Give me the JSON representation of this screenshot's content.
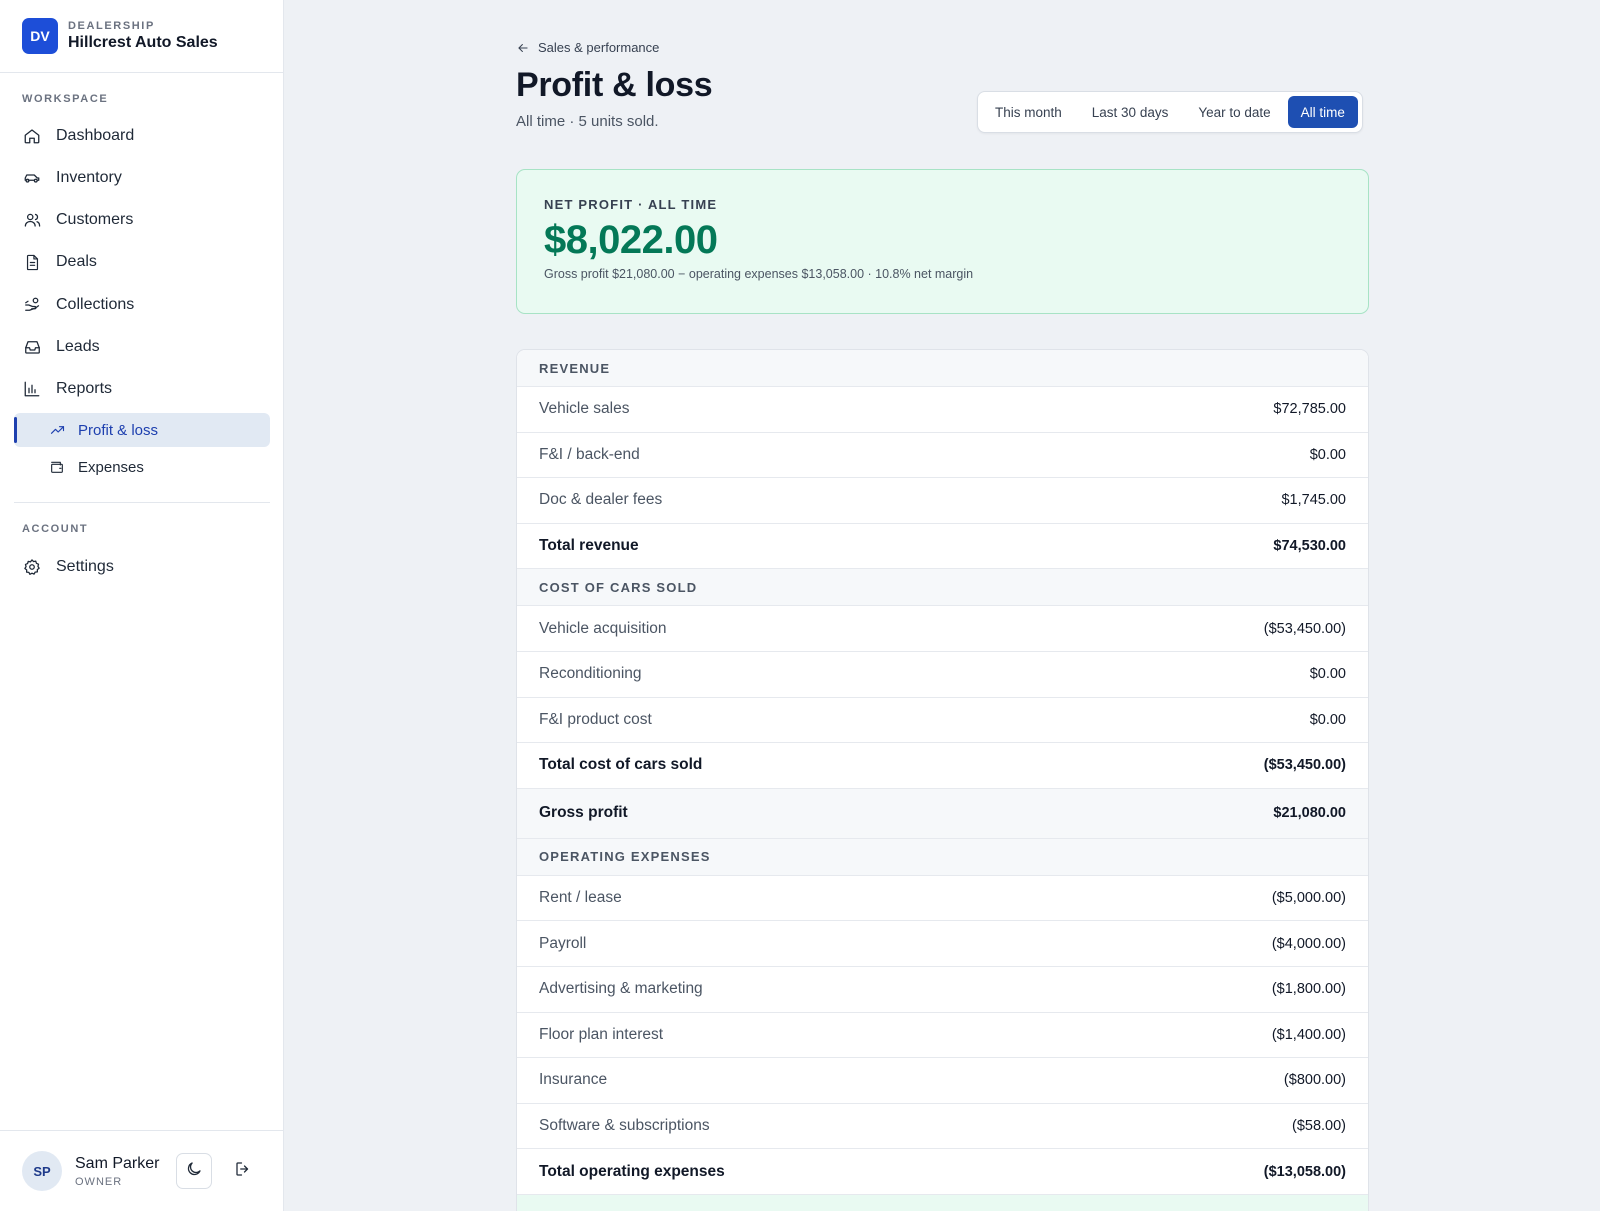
{
  "brand": {
    "badge": "DV",
    "eyebrow": "DEALERSHIP",
    "name": "Hillcrest Auto Sales"
  },
  "sidebar": {
    "workspace_label": "WORKSPACE",
    "items": [
      {
        "label": "Dashboard",
        "icon": "home-icon"
      },
      {
        "label": "Inventory",
        "icon": "car-icon"
      },
      {
        "label": "Customers",
        "icon": "users-icon"
      },
      {
        "label": "Deals",
        "icon": "document-icon"
      },
      {
        "label": "Collections",
        "icon": "hand-coins-icon"
      },
      {
        "label": "Leads",
        "icon": "inbox-icon"
      },
      {
        "label": "Reports",
        "icon": "bar-chart-icon"
      }
    ],
    "sub_items": [
      {
        "label": "Profit & loss",
        "icon": "trending-up-icon",
        "active": true
      },
      {
        "label": "Expenses",
        "icon": "wallet-icon",
        "active": false
      }
    ],
    "account_label": "ACCOUNT",
    "settings_label": "Settings"
  },
  "user": {
    "initials": "SP",
    "name": "Sam Parker",
    "role": "OWNER"
  },
  "header": {
    "back_label": "Sales & performance",
    "title": "Profit & loss",
    "subtitle": "All time · 5 units sold."
  },
  "periods": [
    {
      "label": "This month",
      "active": false
    },
    {
      "label": "Last 30 days",
      "active": false
    },
    {
      "label": "Year to date",
      "active": false
    },
    {
      "label": "All time",
      "active": true
    }
  ],
  "net_profit": {
    "label": "NET PROFIT · ALL TIME",
    "value": "$8,022.00",
    "detail": "Gross profit $21,080.00 − operating expenses $13,058.00 · 10.8% net margin"
  },
  "statement": {
    "revenue": {
      "header": "REVENUE",
      "rows": [
        {
          "label": "Vehicle sales",
          "value": "$72,785.00"
        },
        {
          "label": "F&I / back-end",
          "value": "$0.00"
        },
        {
          "label": "Doc & dealer fees",
          "value": "$1,745.00"
        }
      ],
      "total_label": "Total revenue",
      "total_value": "$74,530.00"
    },
    "cogs": {
      "header": "COST OF CARS SOLD",
      "rows": [
        {
          "label": "Vehicle acquisition",
          "value": "($53,450.00)"
        },
        {
          "label": "Reconditioning",
          "value": "$0.00"
        },
        {
          "label": "F&I product cost",
          "value": "$0.00"
        }
      ],
      "total_label": "Total cost of cars sold",
      "total_value": "($53,450.00)"
    },
    "gross": {
      "label": "Gross profit",
      "value": "$21,080.00"
    },
    "opex": {
      "header": "OPERATING EXPENSES",
      "rows": [
        {
          "label": "Rent / lease",
          "value": "($5,000.00)"
        },
        {
          "label": "Payroll",
          "value": "($4,000.00)"
        },
        {
          "label": "Advertising & marketing",
          "value": "($1,800.00)"
        },
        {
          "label": "Floor plan interest",
          "value": "($1,400.00)"
        },
        {
          "label": "Insurance",
          "value": "($800.00)"
        },
        {
          "label": "Software & subscriptions",
          "value": "($58.00)"
        }
      ],
      "total_label": "Total operating expenses",
      "total_value": "($13,058.00)"
    }
  },
  "colors": {
    "accent": "#1e4fb2",
    "brand": "#1d4ed8",
    "profit": "#047857",
    "profit_bg": "#e9faf2"
  }
}
